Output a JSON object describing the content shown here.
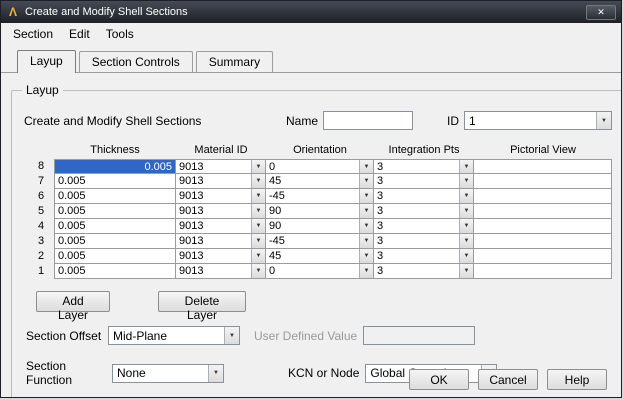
{
  "window": {
    "title": "Create and Modify Shell Sections",
    "close_glyph": "✕",
    "logo_glyph": "Λ"
  },
  "menu": {
    "items": [
      {
        "label": "Section"
      },
      {
        "label": "Edit"
      },
      {
        "label": "Tools"
      }
    ]
  },
  "tabs": [
    {
      "label": "Layup"
    },
    {
      "label": "Section Controls"
    },
    {
      "label": "Summary"
    }
  ],
  "layup": {
    "group_title": "Layup",
    "section_label": "Create and Modify Shell Sections",
    "name_label": "Name",
    "name_value": "",
    "id_label": "ID",
    "id_value": "1",
    "table": {
      "headers": [
        "Thickness",
        "Material ID",
        "Orientation",
        "Integration Pts",
        "Pictorial View"
      ],
      "rows": [
        {
          "num": "8",
          "thickness": "0.005",
          "material": "9013",
          "orientation": "0",
          "pts": "3",
          "pattern": "horizontal"
        },
        {
          "num": "7",
          "thickness": "0.005",
          "material": "9013",
          "orientation": "45",
          "pts": "3",
          "pattern": "slash"
        },
        {
          "num": "6",
          "thickness": "0.005",
          "material": "9013",
          "orientation": "-45",
          "pts": "3",
          "pattern": "backslash"
        },
        {
          "num": "5",
          "thickness": "0.005",
          "material": "9013",
          "orientation": "90",
          "pts": "3",
          "pattern": "vertical"
        },
        {
          "num": "4",
          "thickness": "0.005",
          "material": "9013",
          "orientation": "90",
          "pts": "3",
          "pattern": "vertical"
        },
        {
          "num": "3",
          "thickness": "0.005",
          "material": "9013",
          "orientation": "-45",
          "pts": "3",
          "pattern": "backslash"
        },
        {
          "num": "2",
          "thickness": "0.005",
          "material": "9013",
          "orientation": "45",
          "pts": "3",
          "pattern": "slash"
        },
        {
          "num": "1",
          "thickness": "0.005",
          "material": "9013",
          "orientation": "0",
          "pts": "3",
          "pattern": "horizontal"
        }
      ]
    },
    "add_layer_label": "Add Layer",
    "delete_layer_label": "Delete Layer",
    "section_offset_label": "Section Offset",
    "section_offset_value": "Mid-Plane",
    "user_defined_label": "User Defined Value",
    "user_defined_value": "",
    "section_function_label": "Section Function",
    "section_function_value": "None",
    "kcn_label": "KCN or Node",
    "kcn_value": "Global Cartesian"
  },
  "footer": {
    "ok_label": "OK",
    "cancel_label": "Cancel",
    "help_label": "Help"
  },
  "colors": {
    "pictorial_blue": "#1b7de8",
    "selection_blue": "#3166c6"
  }
}
